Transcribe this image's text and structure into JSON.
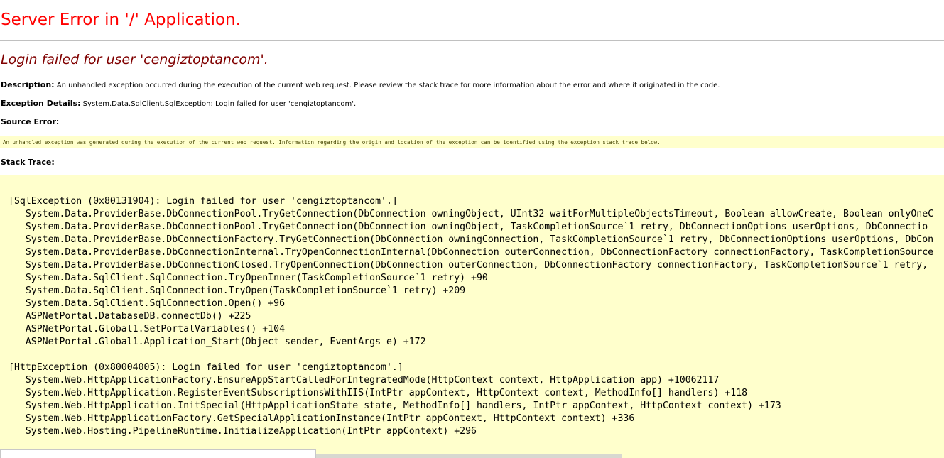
{
  "title": "Server Error in '/' Application.",
  "subtitle": "Login failed for user 'cengiztoptancom'.",
  "description": {
    "label": "Description:",
    "text": "An unhandled exception occurred during the execution of the current web request. Please review the stack trace for more information about the error and where it originated in the code."
  },
  "exception_details": {
    "label": "Exception Details:",
    "text": "System.Data.SqlClient.SqlException: Login failed for user 'cengiztoptancom'."
  },
  "source_error": {
    "label": "Source Error:",
    "text": "An unhandled exception was generated during the execution of the current web request. Information regarding the origin and location of the exception can be identified using the exception stack trace below."
  },
  "stack_trace": {
    "label": "Stack Trace:",
    "lines": [
      "[SqlException (0x80131904): Login failed for user 'cengiztoptancom'.]",
      "   System.Data.ProviderBase.DbConnectionPool.TryGetConnection(DbConnection owningObject, UInt32 waitForMultipleObjectsTimeout, Boolean allowCreate, Boolean onlyOneC",
      "   System.Data.ProviderBase.DbConnectionPool.TryGetConnection(DbConnection owningObject, TaskCompletionSource`1 retry, DbConnectionOptions userOptions, DbConnectio",
      "   System.Data.ProviderBase.DbConnectionFactory.TryGetConnection(DbConnection owningConnection, TaskCompletionSource`1 retry, DbConnectionOptions userOptions, DbCon",
      "   System.Data.ProviderBase.DbConnectionInternal.TryOpenConnectionInternal(DbConnection outerConnection, DbConnectionFactory connectionFactory, TaskCompletionSource",
      "   System.Data.ProviderBase.DbConnectionClosed.TryOpenConnection(DbConnection outerConnection, DbConnectionFactory connectionFactory, TaskCompletionSource`1 retry, ",
      "   System.Data.SqlClient.SqlConnection.TryOpenInner(TaskCompletionSource`1 retry) +90",
      "   System.Data.SqlClient.SqlConnection.TryOpen(TaskCompletionSource`1 retry) +209",
      "   System.Data.SqlClient.SqlConnection.Open() +96",
      "   ASPNetPortal.DatabaseDB.connectDb() +225",
      "   ASPNetPortal.Global1.SetPortalVariables() +104",
      "   ASPNetPortal.Global1.Application_Start(Object sender, EventArgs e) +172",
      "",
      "[HttpException (0x80004005): Login failed for user 'cengiztoptancom'.]",
      "   System.Web.HttpApplicationFactory.EnsureAppStartCalledForIntegratedMode(HttpContext context, HttpApplication app) +10062117",
      "   System.Web.HttpApplication.RegisterEventSubscriptionsWithIIS(IntPtr appContext, HttpContext context, MethodInfo[] handlers) +118",
      "   System.Web.HttpApplication.InitSpecial(HttpApplicationState state, MethodInfo[] handlers, IntPtr appContext, HttpContext context) +173",
      "   System.Web.HttpApplicationFactory.GetSpecialApplicationInstance(IntPtr appContext, HttpContext context) +336",
      "   System.Web.Hosting.PipelineRuntime.InitializeApplication(IntPtr appContext) +296"
    ]
  },
  "colors": {
    "title": "#ff0000",
    "subtitle": "#800000",
    "code_background": "#ffffcc"
  }
}
